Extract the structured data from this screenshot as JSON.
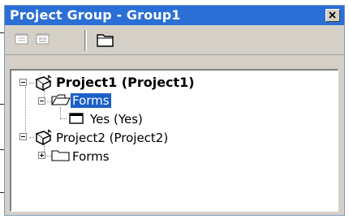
{
  "window": {
    "title": "Project Group - Group1",
    "close_glyph": "×"
  },
  "toolbar": {
    "buttons": [
      {
        "name": "view-object-icon"
      },
      {
        "name": "view-code-icon"
      },
      {
        "name": "toggle-folders-icon"
      }
    ]
  },
  "tree": {
    "project1": {
      "label": "Project1 (Project1)",
      "forms_label": "Forms",
      "form_yes": "Yes (Yes)"
    },
    "project2": {
      "label": "Project2 (Project2)",
      "forms_label": "Forms"
    }
  },
  "colors": {
    "title_bg": "#2a6fd6",
    "selection": "#1b5fc8",
    "window_bg": "#d4d0c8"
  }
}
